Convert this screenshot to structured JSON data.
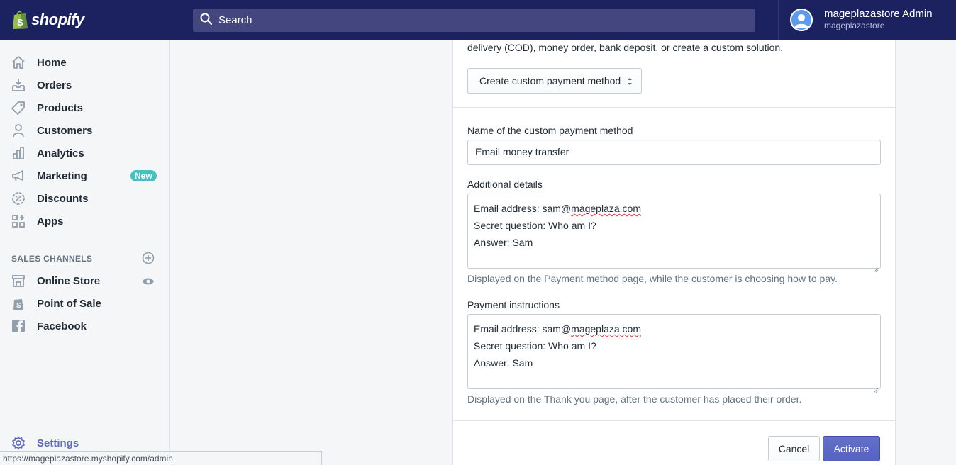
{
  "header": {
    "logo_text": "shopify",
    "search_placeholder": "Search",
    "user_name": "mageplazastore Admin",
    "user_store": "mageplazastore"
  },
  "sidebar": {
    "items": [
      {
        "label": "Home",
        "icon": "home-icon"
      },
      {
        "label": "Orders",
        "icon": "orders-icon"
      },
      {
        "label": "Products",
        "icon": "tag-icon"
      },
      {
        "label": "Customers",
        "icon": "person-icon"
      },
      {
        "label": "Analytics",
        "icon": "bar-chart-icon"
      },
      {
        "label": "Marketing",
        "icon": "megaphone-icon",
        "badge": "New"
      },
      {
        "label": "Discounts",
        "icon": "discount-icon"
      },
      {
        "label": "Apps",
        "icon": "apps-icon"
      }
    ],
    "sales_channels_title": "SALES CHANNELS",
    "channels": [
      {
        "label": "Online Store",
        "icon": "store-icon"
      },
      {
        "label": "Point of Sale",
        "icon": "pos-bag-icon"
      },
      {
        "label": "Facebook",
        "icon": "facebook-icon"
      }
    ],
    "settings_label": "Settings"
  },
  "status_bar_url": "https://mageplazastore.myshopify.com/admin",
  "card": {
    "intro_text": "delivery (COD), money order, bank deposit, or create a custom solution.",
    "select_value": "Create custom payment method",
    "name_label": "Name of the custom payment method",
    "name_value": "Email money transfer",
    "details_label": "Additional details",
    "details_lines": {
      "line1_prefix": "Email address: sam@",
      "line1_domain": "mageplaza.com",
      "line2": "Secret question: Who am I?",
      "line3": "Answer: Sam"
    },
    "details_help": "Displayed on the Payment method page, while the customer is choosing how to pay.",
    "instructions_label": "Payment instructions",
    "instructions_lines": {
      "line1_prefix": "Email address: sam@",
      "line1_domain": "mageplaza.com",
      "line2": "Secret question: Who am I?",
      "line3": "Answer: Sam"
    },
    "instructions_help": "Displayed on the Thank you page, after the customer has placed their order.",
    "cancel_label": "Cancel",
    "activate_label": "Activate"
  },
  "colors": {
    "topbar": "#1c2260",
    "accent": "#5c6ac4",
    "badge_new": "#47c1bf"
  }
}
